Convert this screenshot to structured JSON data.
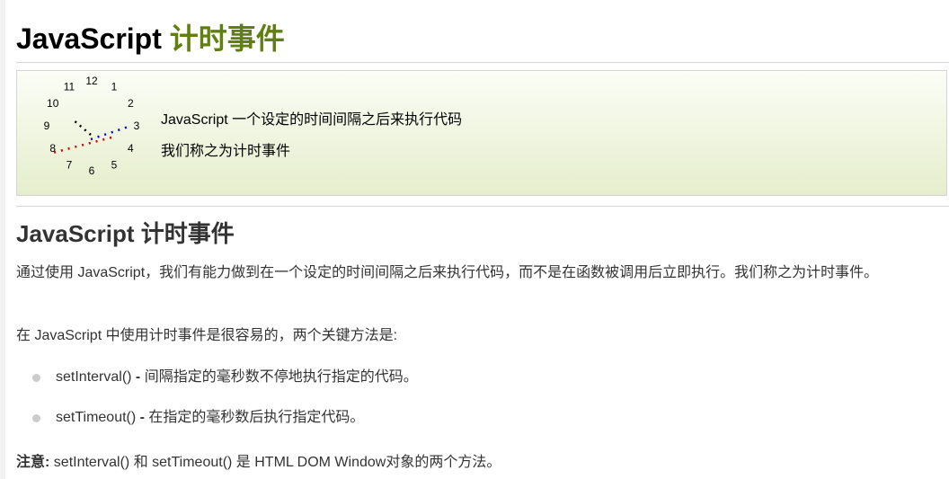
{
  "title": {
    "main": "JavaScript",
    "accent": "计时事件"
  },
  "intro": {
    "line1": "JavaScript 一个设定的时间间隔之后来执行代码",
    "line2": "我们称之为计时事件",
    "clock_numbers": [
      "12",
      "1",
      "2",
      "3",
      "4",
      "5",
      "6",
      "7",
      "8",
      "9",
      "10",
      "11"
    ]
  },
  "section": {
    "heading": "JavaScript 计时事件",
    "para1": "通过使用 JavaScript，我们有能力做到在一个设定的时间间隔之后来执行代码，而不是在函数被调用后立即执行。我们称之为计时事件。",
    "para2": "在 JavaScript 中使用计时事件是很容易的，两个关键方法是:"
  },
  "methods": [
    {
      "name": "setInterval()",
      "sep": " - ",
      "desc": "间隔指定的毫秒数不停地执行指定的代码。"
    },
    {
      "name": "setTimeout()",
      "sep": " - ",
      "desc": "在指定的毫秒数后执行指定代码。"
    }
  ],
  "note": {
    "label": "注意:",
    "text": " setInterval() 和 setTimeout() 是 HTML DOM Window对象的两个方法。"
  },
  "colors": {
    "accent": "#617f10",
    "hand_hour": "#000000",
    "hand_minute": "#0000cc",
    "hand_second": "#cc0000"
  }
}
